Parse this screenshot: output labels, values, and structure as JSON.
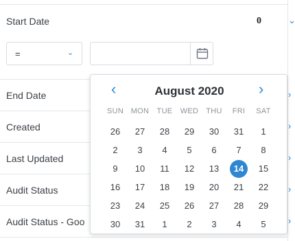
{
  "filters": {
    "start_date": {
      "label": "Start Date",
      "count": "0",
      "operator": {
        "value": "="
      }
    },
    "rows": [
      {
        "label": "End Date"
      },
      {
        "label": "Created"
      },
      {
        "label": "Last Updated"
      },
      {
        "label": "Audit Status"
      },
      {
        "label": "Audit Status - Goo"
      }
    ]
  },
  "calendar": {
    "month_title": "August 2020",
    "prev_symbol": "‹",
    "next_symbol": "›",
    "weekdays": [
      "SUN",
      "MON",
      "TUE",
      "WED",
      "THU",
      "FRI",
      "SAT"
    ],
    "selected_day": "14",
    "days": [
      "26",
      "27",
      "28",
      "29",
      "30",
      "31",
      "1",
      "2",
      "3",
      "4",
      "5",
      "6",
      "7",
      "8",
      "9",
      "10",
      "11",
      "12",
      "13",
      "14",
      "15",
      "16",
      "17",
      "18",
      "19",
      "20",
      "21",
      "22",
      "23",
      "24",
      "25",
      "26",
      "27",
      "28",
      "29",
      "30",
      "31",
      "1",
      "2",
      "3",
      "4",
      "5"
    ]
  },
  "colors": {
    "accent": "#2f86d1",
    "border": "#e3e6ea"
  }
}
